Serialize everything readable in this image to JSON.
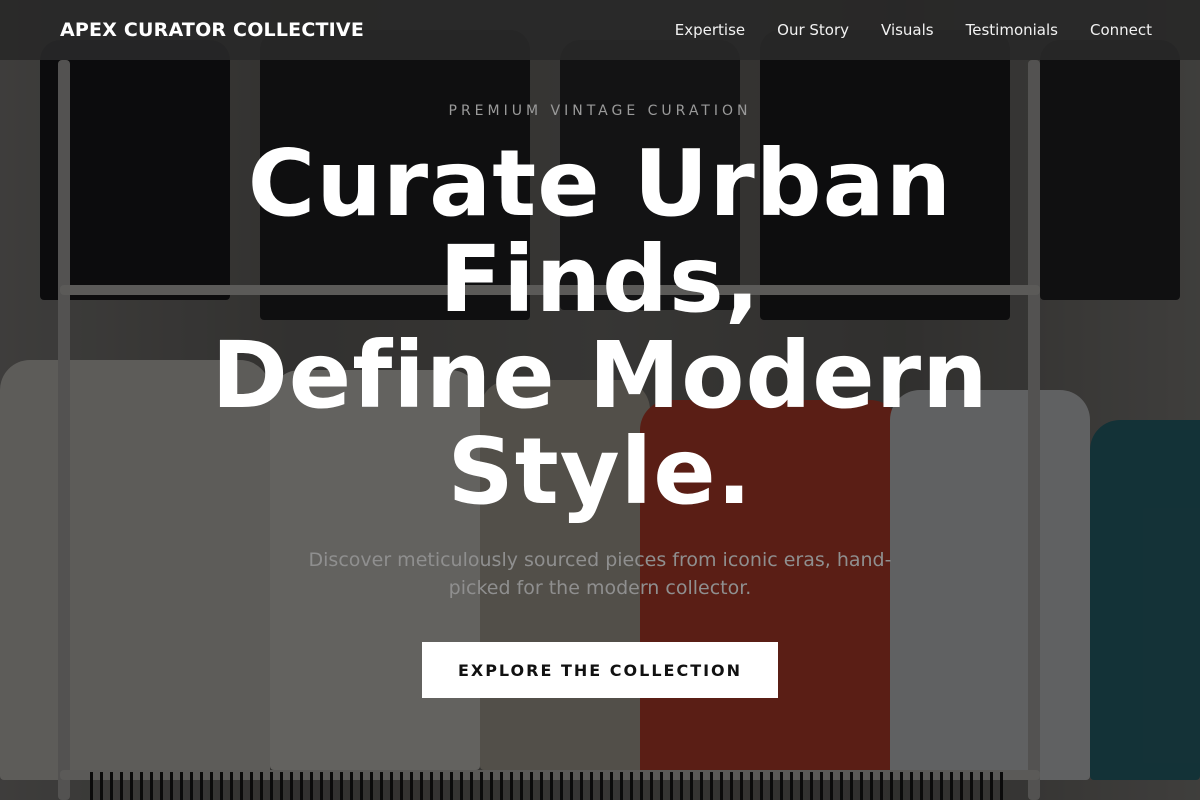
{
  "brand": {
    "name": "APEX CURATOR COLLECTIVE"
  },
  "nav": {
    "items": [
      {
        "label": "Expertise"
      },
      {
        "label": "Our Story"
      },
      {
        "label": "Visuals"
      },
      {
        "label": "Testimonials"
      },
      {
        "label": "Connect"
      }
    ]
  },
  "hero": {
    "eyebrow": "PREMIUM VINTAGE CURATION",
    "headline_lines": [
      "Curate Urban",
      "Finds,",
      "Define Modern",
      "Style."
    ],
    "subhead": "Discover meticulously sourced pieces from iconic eras, hand-picked for the modern collector.",
    "cta_label": "EXPLORE THE COLLECTION"
  },
  "colors": {
    "nav_background": "#2a2a2a",
    "headline": "#ffffff",
    "cta_background": "#ffffff",
    "cta_text": "#111111"
  }
}
